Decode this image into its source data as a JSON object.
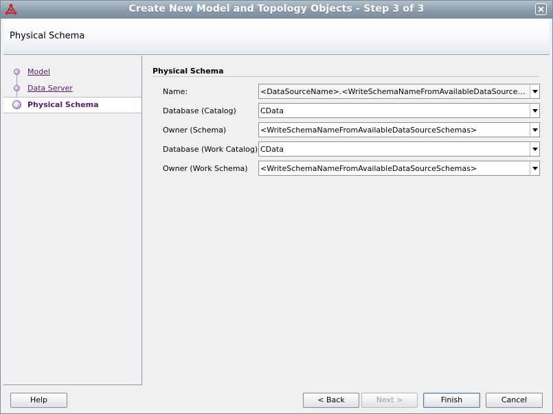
{
  "window": {
    "title": "Create New Model and Topology Objects - Step 3 of 3",
    "icon": "app-logo-icon",
    "close_icon": "close-icon"
  },
  "header": {
    "title": "Physical Schema"
  },
  "steps": [
    {
      "label": "Model",
      "state": "done"
    },
    {
      "label": "Data Server",
      "state": "done"
    },
    {
      "label": "Physical Schema",
      "state": "active"
    }
  ],
  "form": {
    "section_title": "Physical Schema",
    "fields": [
      {
        "label": "Name:",
        "value": "<DataSourceName>.<WriteSchemaNameFromAvailableDataSourceSchemas>"
      },
      {
        "label": "Database (Catalog)",
        "value": "CData"
      },
      {
        "label": "Owner (Schema)",
        "value": "<WriteSchemaNameFromAvailableDataSourceSchemas>"
      },
      {
        "label": "Database (Work Catalog)",
        "value": "CData"
      },
      {
        "label": "Owner (Work Schema)",
        "value": "<WriteSchemaNameFromAvailableDataSourceSchemas>"
      }
    ]
  },
  "buttons": {
    "help": "Help",
    "back": "< Back",
    "next": "Next >",
    "finish": "Finish",
    "cancel": "Cancel"
  },
  "colors": {
    "titlebar": "#8c9cac",
    "step_link": "#5a1a6a",
    "step_dot": "#b197c4"
  }
}
